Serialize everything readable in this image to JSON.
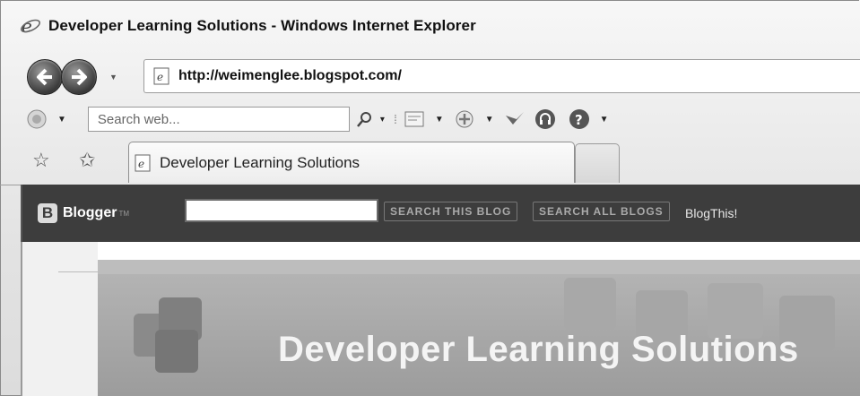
{
  "window": {
    "title": "Developer Learning Solutions - Windows Internet Explorer"
  },
  "address": {
    "url": "http://weimenglee.blogspot.com/"
  },
  "toolbar": {
    "search_placeholder": "Search web..."
  },
  "tabs": [
    {
      "label": "Developer Learning Solutions"
    }
  ],
  "blogger": {
    "logo": "Blogger",
    "tm": "TM",
    "search_this_blog": "SEARCH THIS BLOG",
    "search_all_blogs": "SEARCH ALL BLOGS",
    "blogthis": "BlogThis!"
  },
  "blog": {
    "title": "Developer Learning Solutions"
  }
}
